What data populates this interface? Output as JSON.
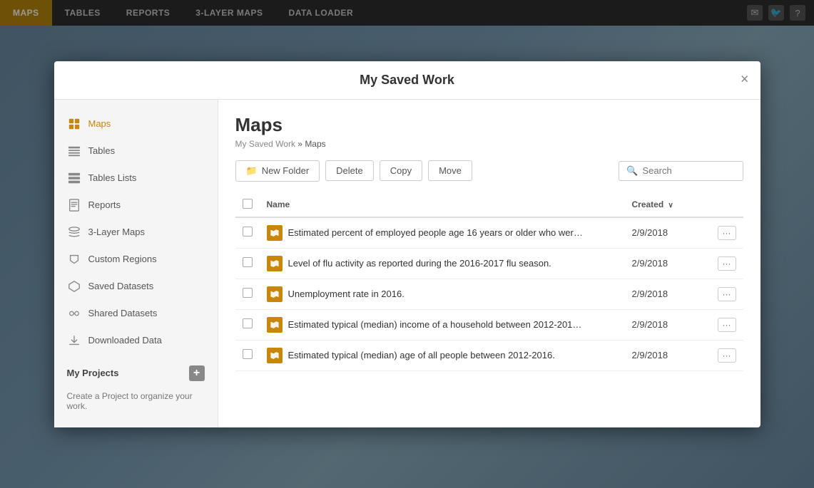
{
  "app": {
    "nav_items": [
      "MAPS",
      "TABLES",
      "REPORTS",
      "3-LAYER MAPS",
      "DATA LOADER"
    ],
    "active_nav": "MAPS"
  },
  "modal": {
    "title": "My Saved Work",
    "close_label": "×"
  },
  "sidebar": {
    "items": [
      {
        "id": "maps",
        "label": "Maps",
        "active": true
      },
      {
        "id": "tables",
        "label": "Tables",
        "active": false
      },
      {
        "id": "tables-lists",
        "label": "Tables Lists",
        "active": false
      },
      {
        "id": "reports",
        "label": "Reports",
        "active": false
      },
      {
        "id": "3layer-maps",
        "label": "3-Layer Maps",
        "active": false
      },
      {
        "id": "custom-regions",
        "label": "Custom Regions",
        "active": false
      },
      {
        "id": "saved-datasets",
        "label": "Saved Datasets",
        "active": false
      },
      {
        "id": "shared-datasets",
        "label": "Shared Datasets",
        "active": false
      },
      {
        "id": "downloaded-data",
        "label": "Downloaded Data",
        "active": false
      }
    ],
    "projects_title": "My Projects",
    "projects_add_label": "+",
    "projects_empty": "Create a Project to organize your work."
  },
  "main": {
    "page_title": "Maps",
    "breadcrumb_root": "My Saved Work",
    "breadcrumb_sep": " » ",
    "breadcrumb_current": "Maps",
    "toolbar": {
      "new_folder_label": "New Folder",
      "delete_label": "Delete",
      "copy_label": "Copy",
      "move_label": "Move",
      "search_placeholder": "Search"
    },
    "table": {
      "col_name": "Name",
      "col_created": "Created",
      "sort_indicator": "∨",
      "rows": [
        {
          "name": "Estimated percent of employed people age 16 years or older who wer…",
          "created": "2/9/2018"
        },
        {
          "name": "Level of flu activity as reported during the 2016-2017 flu season.",
          "created": "2/9/2018"
        },
        {
          "name": "Unemployment rate in 2016.",
          "created": "2/9/2018"
        },
        {
          "name": "Estimated typical (median) income of a household between 2012-201…",
          "created": "2/9/2018"
        },
        {
          "name": "Estimated typical (median) age of all people between 2012-2016.",
          "created": "2/9/2018"
        }
      ],
      "actions_label": "···"
    }
  }
}
